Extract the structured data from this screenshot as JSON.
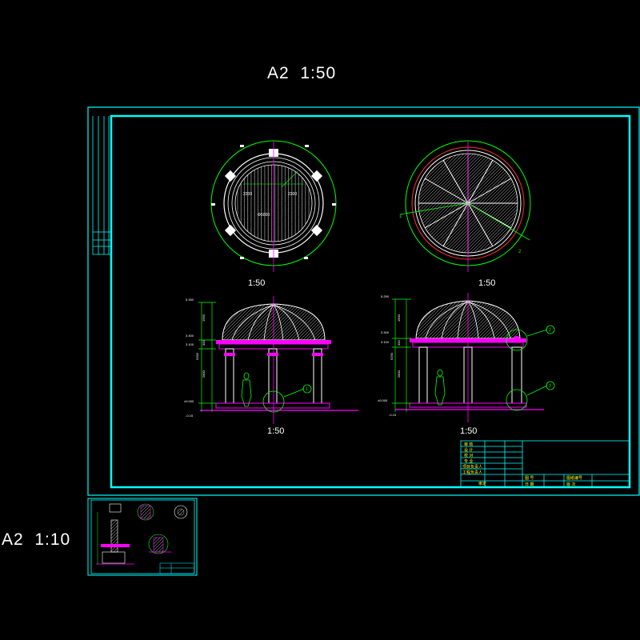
{
  "sheets": {
    "main_label": "A2  1:50",
    "detail_label": "A2  1:10"
  },
  "drawing": {
    "plan_left_scale": "1:50",
    "plan_right_scale": "1:50",
    "elevation_scale": "1:50",
    "elev_left_levels": [
      "5.350",
      "3.400",
      "3.100",
      "±0.000",
      "-0.15"
    ],
    "elev_left_dims": [
      "1550",
      "300",
      "2800",
      "5350"
    ],
    "elev_right_levels": [
      "5.290",
      "3.300",
      "3.100",
      "±0.000",
      "-0.15"
    ],
    "elev_right_dims": [
      "1900",
      "300",
      "2800",
      "5290"
    ],
    "plan_left_dims": [
      "2200",
      "2200",
      "Φ5000"
    ],
    "callout_left": "1",
    "callout_right_a": "2",
    "callout_right_b": "3",
    "section_marker_a": "1",
    "section_marker_b": "2"
  },
  "title_block": {
    "rows": [
      "审 核",
      "设 计",
      "校 对",
      "专 业",
      "项目负责人",
      "工程负责人"
    ],
    "approve": "审定",
    "drawing_no_label": "图 号",
    "date_label": "日 期",
    "sheet_no_label": "图纸编号",
    "version_label": "版 次"
  },
  "colors": {
    "frame": "#00ffff",
    "geometry": "#ffffff",
    "accent": "#ff00ff",
    "dimension": "#00ff00",
    "inner_ring": "#ff3030"
  }
}
